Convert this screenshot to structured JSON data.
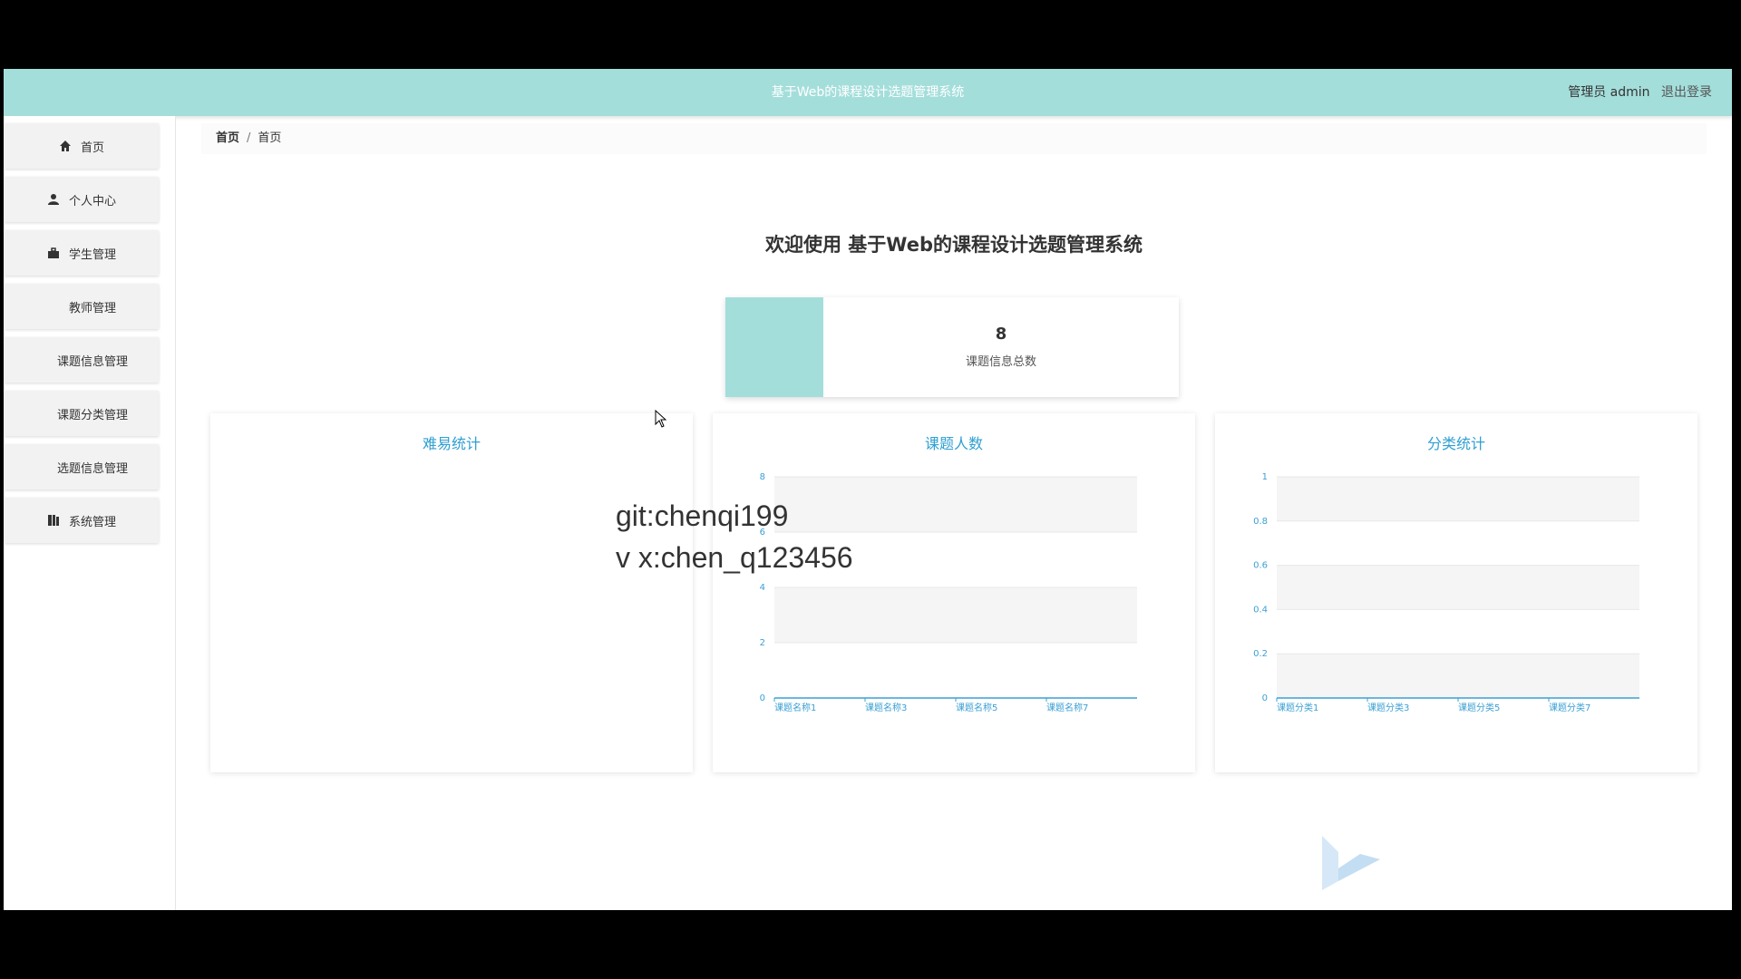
{
  "header": {
    "title": "基于Web的课程设计选题管理系统",
    "user": "管理员 admin",
    "logout": "退出登录"
  },
  "sidebar": {
    "items": [
      {
        "label": "首页",
        "icon": "home-icon"
      },
      {
        "label": "个人中心",
        "icon": "user-icon"
      },
      {
        "label": "学生管理",
        "icon": "briefcase-icon"
      },
      {
        "label": "教师管理",
        "icon": "grid-icon"
      },
      {
        "label": "课题信息管理",
        "icon": "grid-icon"
      },
      {
        "label": "课题分类管理",
        "icon": "grid-icon"
      },
      {
        "label": "选题信息管理",
        "icon": "grid-icon"
      },
      {
        "label": "系统管理",
        "icon": "book-icon"
      }
    ]
  },
  "breadcrumb": {
    "first": "首页",
    "separator": "/",
    "current": "首页"
  },
  "welcome": "欢迎使用 基于Web的课程设计选题管理系统",
  "stat": {
    "value": "8",
    "label": "课题信息总数"
  },
  "colors": {
    "accent": "#a4dedb",
    "chart_text": "#3aa0d4"
  },
  "panels": {
    "difficulty": "难易统计",
    "headcount": "课题人数",
    "category": "分类统计"
  },
  "watermark": {
    "line1": "git:chenqi199",
    "line2": "v x:chen_q123456"
  },
  "chart_data": [
    {
      "type": "bar",
      "title": "课题人数",
      "categories": [
        "课题名称1",
        "课题名称3",
        "课题名称5",
        "课题名称7"
      ],
      "yticks": [
        "0",
        "2",
        "4",
        "6",
        "8"
      ],
      "ylim": [
        0,
        8
      ],
      "values": [
        0,
        0,
        0,
        0
      ]
    },
    {
      "type": "bar",
      "title": "分类统计",
      "categories": [
        "课题分类1",
        "课题分类3",
        "课题分类5",
        "课题分类7"
      ],
      "yticks": [
        "0",
        "0.2",
        "0.4",
        "0.6",
        "0.8",
        "1"
      ],
      "ylim": [
        0,
        1
      ],
      "values": [
        0,
        0,
        0,
        0
      ]
    }
  ]
}
